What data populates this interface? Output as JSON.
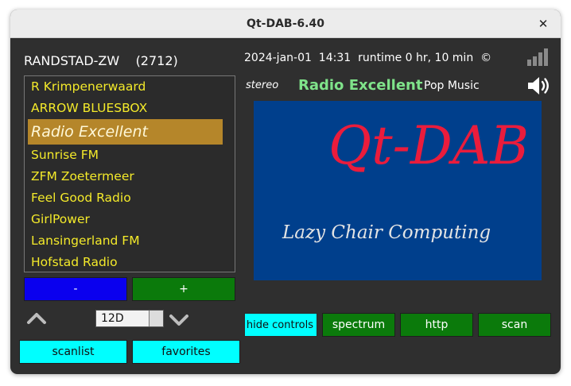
{
  "window": {
    "title": "Qt-DAB-6.40",
    "close_label": "✕"
  },
  "ensemble": {
    "name": "RANDSTAD-ZW",
    "id": "(2712)"
  },
  "services": [
    "R Krimpenerwaard",
    "ARROW BLUESBOX",
    "Radio Excellent",
    "Sunrise FM",
    "ZFM Zoetermeer",
    "Feel Good Radio",
    "GirlPower",
    "Lansingerland FM",
    "Hofstad Radio"
  ],
  "selected_service": "Radio Excellent",
  "buttons": {
    "minus": "-",
    "plus": "+",
    "scanlist": "scanlist",
    "favorites": "favorites",
    "hide_controls": "hide controls",
    "spectrum": "spectrum",
    "http": "http",
    "scan": "scan"
  },
  "channel": {
    "selected": "12D"
  },
  "status": {
    "date": "2024-jan-01",
    "time": "14:31",
    "runtime": "runtime 0 hr, 10 min",
    "copyright_symbol": "©"
  },
  "audio": {
    "mode": "stereo"
  },
  "current": {
    "station": "Radio Excellent",
    "genre": "Pop Music"
  },
  "slide": {
    "title": "Qt-DAB",
    "subtitle": "Lazy Chair Computing"
  },
  "icons": {
    "signal": "signal-strength-icon",
    "speaker": "speaker-icon",
    "up": "chevron-up-icon",
    "down": "chevron-down-icon"
  },
  "colors": {
    "window_bg": "#2f2f2f",
    "service_text": "#f4ea2a",
    "selected_bg": "#b5862a",
    "station_text": "#7fe38a",
    "minus_bg": "#0a00ee",
    "green_button": "#0b7a0b",
    "cyan_button": "#00ffff",
    "slide_bg": "#003f8c",
    "slide_title": "#ea1c3c"
  }
}
